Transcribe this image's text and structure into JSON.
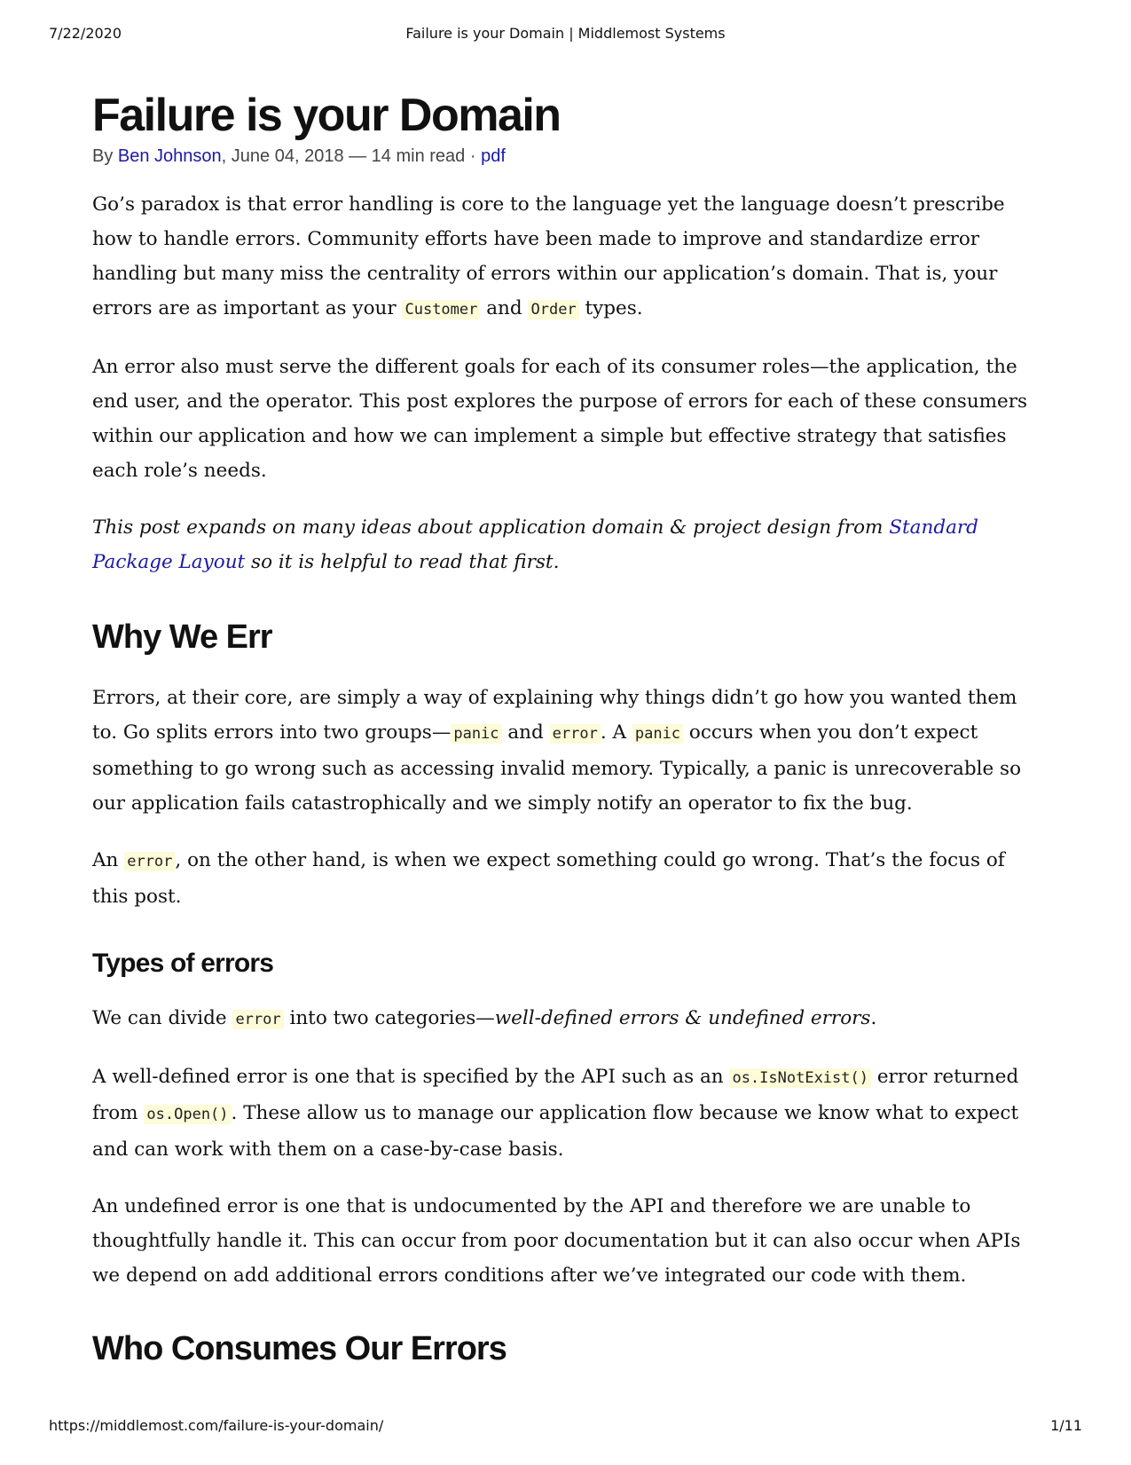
{
  "print_header": {
    "date": "7/22/2020",
    "title": "Failure is your Domain | Middlemost Systems"
  },
  "article": {
    "title": "Failure is your Domain",
    "byline": {
      "prefix": "By ",
      "author": "Ben Johnson",
      "date_read": ", June 04, 2018 — 14 min read · ",
      "pdf_link": "pdf"
    },
    "intro_p1": {
      "text_a": "Go’s paradox is that error handling is core to the language yet the language doesn’t prescribe how to handle errors. Community efforts have been made to improve and standardize error handling but many miss the centrality of errors within our application’s domain. That is, your errors are as important as your ",
      "code_customer": "Customer",
      "text_b": " and ",
      "code_order": "Order",
      "text_c": " types."
    },
    "intro_p2": "An error also must serve the different goals for each of its consumer roles—the application, the end user, and the operator. This post explores the purpose of errors for each of these consumers within our application and how we can implement a simple but effective strategy that satisfies each role’s needs.",
    "intro_p3": {
      "text_a": "This post expands on many ideas about application domain & project design from ",
      "link": "Standard Package Layout",
      "text_b": " so it is helpful to read that first."
    },
    "section_why": {
      "heading": "Why We Err",
      "p1": {
        "text_a": "Errors, at their core, are simply a way of explaining why things didn’t go how you wanted them to. Go splits errors into two groups—",
        "code_panic": "panic",
        "text_b": " and ",
        "code_error": "error",
        "text_c": ". A ",
        "code_panic2": "panic",
        "text_d": " occurs when you don’t expect something to go wrong such as accessing invalid memory. Typically, a panic is unrecoverable so our application fails catastrophically and we simply notify an operator to fix the bug."
      },
      "p2": {
        "text_a": "An ",
        "code_error": "error",
        "text_b": ", on the other hand, is when we expect something could go wrong. That’s the focus of this post."
      }
    },
    "section_types": {
      "heading": "Types of errors",
      "p1": {
        "text_a": "We can divide ",
        "code_error": "error",
        "text_b": " into two categories—",
        "italic": "well-defined errors & undefined errors",
        "text_c": "."
      },
      "p2": {
        "text_a": "A well-defined error is one that is specified by the API such as an ",
        "code_isnotexist": "os.IsNotExist()",
        "text_b": " error returned from ",
        "code_open": "os.Open()",
        "text_c": ". These allow us to manage our application flow because we know what to expect and can work with them on a case-by-case basis."
      },
      "p3": "An undefined error is one that is undocumented by the API and therefore we are unable to thoughtfully handle it. This can occur from poor documentation but it can also occur when APIs we depend on add additional errors conditions after we’ve integrated our code with them."
    },
    "section_consumers": {
      "heading": "Who Consumes Our Errors"
    }
  },
  "print_footer": {
    "url": "https://middlemost.com/failure-is-your-domain/",
    "page": "1/11"
  },
  "colors": {
    "link": "#1a1aa6",
    "code_background": "#fdfbd8",
    "text": "#111111"
  }
}
